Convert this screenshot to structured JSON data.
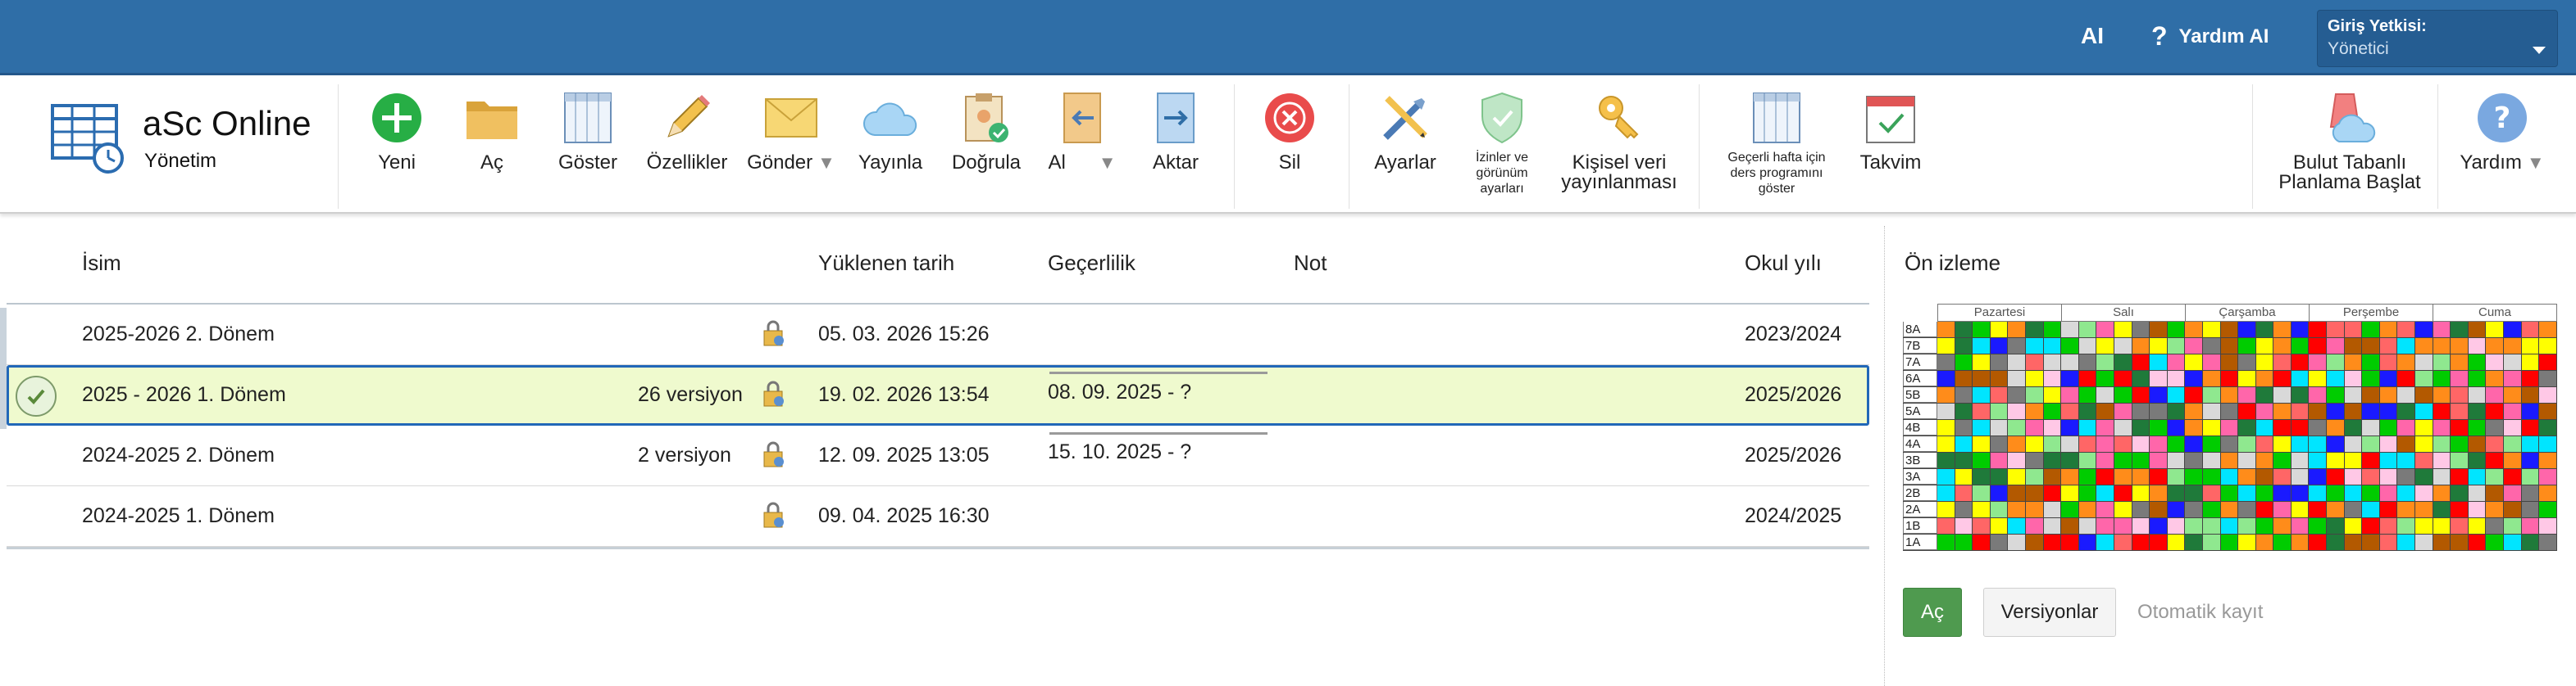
{
  "topbar": {
    "ai_label": "AI",
    "help_label": "Yardım AI",
    "login_title": "Giriş Yetkisi:",
    "login_value": "Yönetici"
  },
  "brand": {
    "title": "aSc Online",
    "subtitle": "Yönetim"
  },
  "toolbar": {
    "new": "Yeni",
    "open": "Aç",
    "show": "Göster",
    "properties": "Özellikler",
    "send": "Gönder",
    "publish": "Yayınla",
    "verify": "Doğrula",
    "import": "Al",
    "export": "Aktar",
    "delete": "Sil",
    "settings": "Ayarlar",
    "permissions": "İzinler ve görünüm ayarları",
    "personal_data": "Kişisel veri yayınlanması",
    "week_schedule": "Geçerli hafta için ders programını göster",
    "calendar": "Takvim",
    "cloud_planning": "Bulut Tabanlı Planlama Başlat",
    "help": "Yardım"
  },
  "table": {
    "headers": {
      "name": "İsim",
      "uploaded": "Yüklenen tarih",
      "validity": "Geçerlilik",
      "note": "Not",
      "school_year": "Okul yılı"
    },
    "rows": [
      {
        "name": "2025-2026 2. Dönem",
        "versions": "",
        "uploaded": "05. 03. 2026 15:26",
        "validity": "",
        "note": "",
        "school_year": "2023/2024"
      },
      {
        "name": "2025 - 2026 1. Dönem",
        "versions": "26 versiyon",
        "uploaded": "19. 02. 2026 13:54",
        "validity": "08. 09. 2025 - ?",
        "note": "",
        "school_year": "2025/2026"
      },
      {
        "name": "2024-2025 2. Dönem",
        "versions": "2 versiyon",
        "uploaded": "12. 09. 2025 13:05",
        "validity": "15. 10. 2025 - ?",
        "note": "",
        "school_year": "2025/2026"
      },
      {
        "name": "2024-2025 1. Dönem",
        "versions": "",
        "uploaded": "09. 04. 2025 16:30",
        "validity": "",
        "note": "",
        "school_year": "2024/2025"
      }
    ]
  },
  "preview": {
    "title": "Ön izleme",
    "days": [
      "Pazartesi",
      "Salı",
      "Çarşamba",
      "Perşembe",
      "Cuma"
    ],
    "classes": [
      "8A",
      "7B",
      "7A",
      "6A",
      "5B",
      "5A",
      "4B",
      "4A",
      "3B",
      "3A",
      "2B",
      "2A",
      "1B",
      "1A"
    ],
    "open_button": "Aç",
    "versions_button": "Versiyonlar",
    "autosave": "Otomatik kayıt"
  },
  "colors": {
    "topbar": "#2f6ea7",
    "selected_row": "#efface",
    "selected_border": "#2167b8",
    "open_button": "#4f9a4f",
    "palette": [
      "#ff0000",
      "#00cc00",
      "#1a1aff",
      "#ffff00",
      "#00e5ff",
      "#ff66aa",
      "#ff8c1a",
      "#1f7a3a",
      "#8fe88f",
      "#b35900",
      "#7a7a7a",
      "#ffc8e6",
      "#d9d9d9",
      "#ff6666"
    ]
  }
}
